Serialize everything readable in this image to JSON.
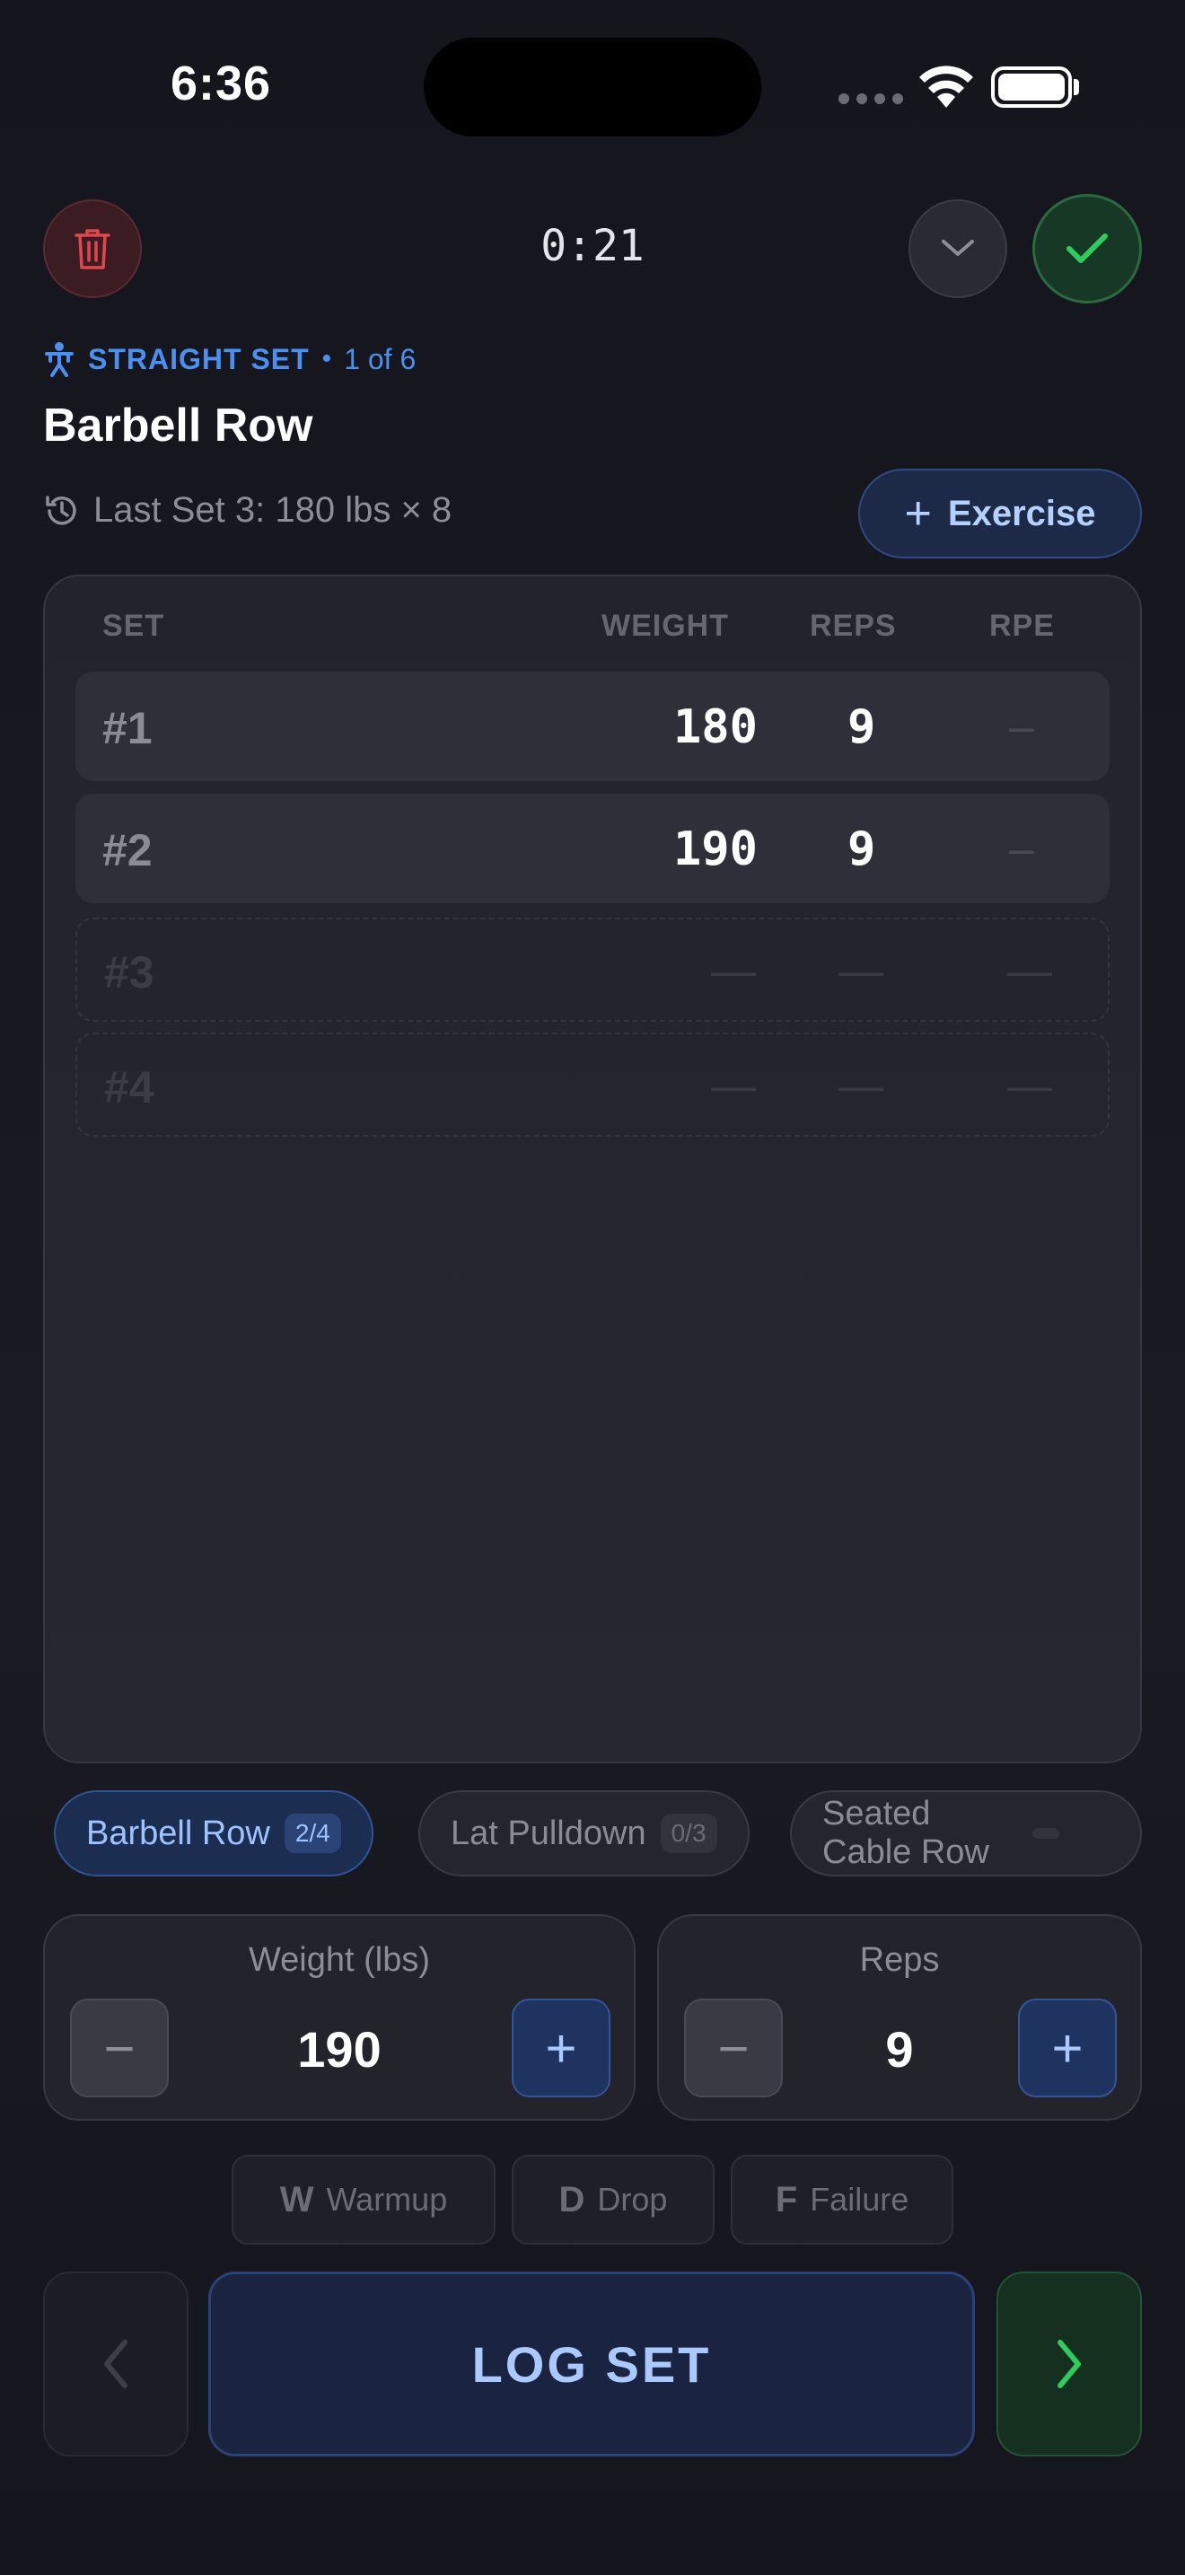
{
  "status_bar": {
    "time": "6:36"
  },
  "toolbar": {
    "timer": "0:21"
  },
  "exercise": {
    "set_type": "STRAIGHT SET",
    "separator": "•",
    "position": "1 of 6",
    "name": "Barbell Row",
    "last_set": "Last Set 3: 180 lbs × 8",
    "add_button": "Exercise"
  },
  "table": {
    "headers": {
      "set": "SET",
      "weight": "WEIGHT",
      "reps": "REPS",
      "rpe": "RPE"
    },
    "rows": [
      {
        "set": "#1",
        "weight": "180",
        "reps": "9",
        "rpe": "–"
      },
      {
        "set": "#2",
        "weight": "190",
        "reps": "9",
        "rpe": "–"
      },
      {
        "set": "#3",
        "weight": "—",
        "reps": "—",
        "rpe": "—"
      },
      {
        "set": "#4",
        "weight": "—",
        "reps": "—",
        "rpe": "—"
      }
    ]
  },
  "exercise_pills": [
    {
      "name": "Barbell Row",
      "progress": "2/4"
    },
    {
      "name": "Lat Pulldown",
      "progress": "0/3"
    },
    {
      "name": "Seated Cable Row",
      "progress": ""
    }
  ],
  "weight_stepper": {
    "label": "Weight (lbs)",
    "value": "190",
    "minus": "−",
    "plus": "+"
  },
  "reps_stepper": {
    "label": "Reps",
    "value": "9",
    "minus": "−",
    "plus": "+"
  },
  "set_tags": [
    {
      "key": "W",
      "label": "Warmup"
    },
    {
      "key": "D",
      "label": "Drop"
    },
    {
      "key": "F",
      "label": "Failure"
    }
  ],
  "actions": {
    "log_set": "LOG SET"
  },
  "colors": {
    "accent_blue": "#4a90f0",
    "success_green": "#2ecc5b",
    "danger_red": "#e0474c"
  }
}
